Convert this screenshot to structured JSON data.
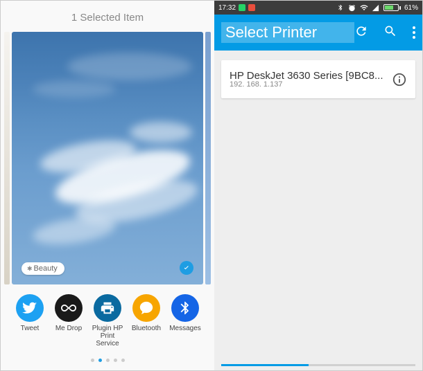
{
  "left": {
    "title": "1 Selected Item",
    "beauty_label": "Beauty",
    "share": [
      {
        "id": "twitter-icon",
        "label": "Tweet"
      },
      {
        "id": "infinity-icon",
        "label": "Me Drop"
      },
      {
        "id": "printer-icon",
        "label": "Plugin HP Print Service"
      },
      {
        "id": "messages-icon",
        "label": "Bluetooth"
      },
      {
        "id": "bluetooth-icon",
        "label": "Messages"
      }
    ],
    "dots_total": 5,
    "dots_active": 1
  },
  "right": {
    "status": {
      "time": "17:32",
      "battery_pct": "61%"
    },
    "app_bar_title": "Select Printer",
    "printer": {
      "name": "HP DeskJet 3630 Series [9BC8...",
      "ip": "192. 168. 1.137"
    }
  }
}
